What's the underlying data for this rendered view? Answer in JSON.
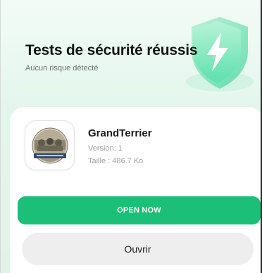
{
  "header": {
    "title": "Tests de sécurité réussis",
    "subtitle": "Aucun risque détecté",
    "shield_icon": "shield-lightning-icon"
  },
  "app": {
    "name": "GrandTerrier",
    "version": "Version: 1",
    "size": "Taille : 486.7 Ko",
    "icon": "app-logo-icon"
  },
  "actions": {
    "primary_label": "OPEN NOW",
    "secondary_label": "Ouvrir"
  },
  "colors": {
    "accent": "#1cbf78",
    "background_tint": "#e3f6ec",
    "secondary_button": "#eeeeef"
  }
}
